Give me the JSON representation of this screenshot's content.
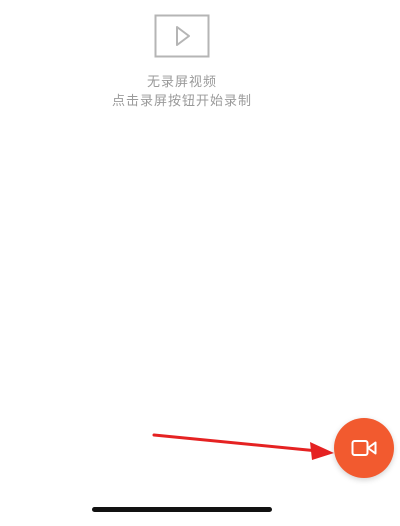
{
  "empty_state": {
    "icon": "video-play-icon",
    "title": "无录屏视频",
    "hint": "点击录屏按钮开始录制"
  },
  "record_button": {
    "icon": "video-camera-icon",
    "color": "#f25a2f"
  },
  "annotation": {
    "arrow_color": "#e52222"
  },
  "colors": {
    "background": "#ffffff",
    "muted_text": "#9a9a9a",
    "placeholder_icon": "#b5b5b5"
  }
}
